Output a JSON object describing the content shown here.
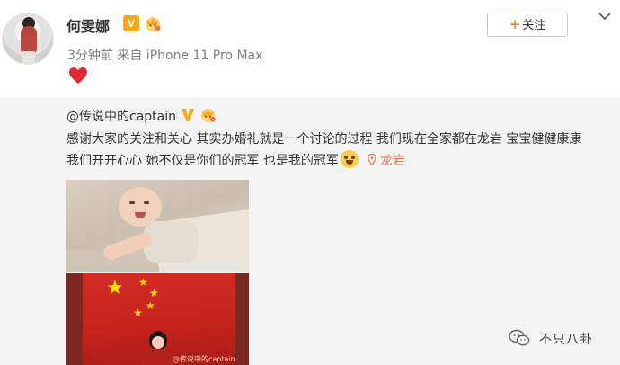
{
  "post": {
    "author": "何雯娜",
    "verified_badge": "V",
    "meta": "3分钟前 来自 iPhone 11 Pro Max",
    "content_emoji": "heart",
    "follow_label": "关注",
    "follow_icon": "plus-icon",
    "menu_icon": "chevron-down-icon"
  },
  "repost": {
    "author": "@传说中的captain",
    "verified_badge": "V",
    "text_line1": "感谢大家的关注和关心 其实办婚礼就是一个讨论的过程 我们现在全家都在龙岩 宝宝健健康康",
    "text_line2": "我们开开心心 她不仅是你们的冠军 也是我的冠军",
    "location": "龙岩",
    "photo2_watermark": "@传说中的captain"
  },
  "brand": {
    "name": "不只八卦",
    "icon": "wechat-icon"
  },
  "colors": {
    "accent_orange": "#f7841e",
    "verified_gold": "#f7a81b",
    "location_red": "#eb7350",
    "repost_bg": "#f3f3f3"
  }
}
